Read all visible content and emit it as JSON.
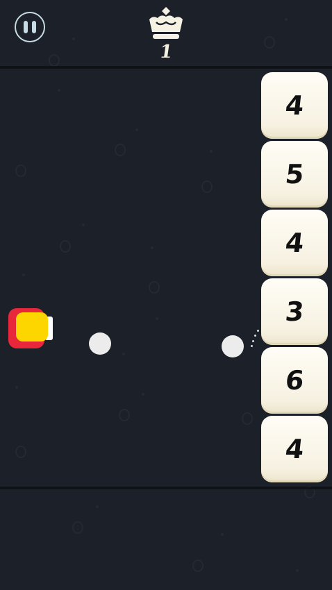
{
  "hud": {
    "score": "1",
    "pause_icon": "pause-icon",
    "crown_icon": "crown-icon"
  },
  "blocks": [
    "4",
    "5",
    "4",
    "3",
    "6",
    "4"
  ],
  "colors": {
    "background": "#1b2029",
    "block": "#f6f1e1",
    "ball": "#ececec",
    "player_red": "#e8283a",
    "player_yellow": "#fdd600"
  }
}
